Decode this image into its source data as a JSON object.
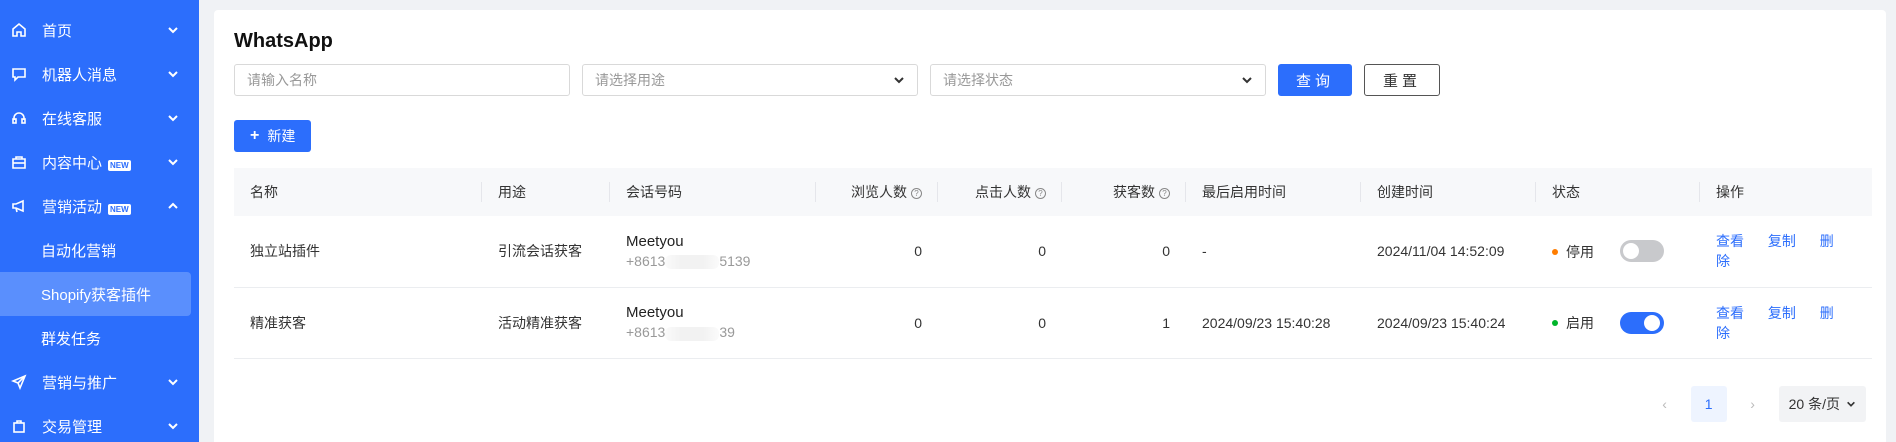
{
  "sidebar": {
    "items": [
      {
        "label": "首页",
        "icon": "home-icon"
      },
      {
        "label": "机器人消息",
        "icon": "chat-icon"
      },
      {
        "label": "在线客服",
        "icon": "headset-icon"
      },
      {
        "label": "内容中心",
        "icon": "folder-icon",
        "badge": "NEW"
      },
      {
        "label": "营销活动",
        "icon": "megaphone-icon",
        "badge": "NEW"
      },
      {
        "label": "营销与推广",
        "icon": "send-icon"
      },
      {
        "label": "交易管理",
        "icon": "bag-icon"
      }
    ],
    "subitems": [
      {
        "label": "自动化营销"
      },
      {
        "label": "Shopify获客插件"
      },
      {
        "label": "群发任务"
      }
    ]
  },
  "page": {
    "title": "WhatsApp"
  },
  "filters": {
    "name_placeholder": "请输入名称",
    "purpose_placeholder": "请选择用途",
    "status_placeholder": "请选择状态",
    "search_label": "查询",
    "reset_label": "重置"
  },
  "toolbar": {
    "new_label": "新建"
  },
  "table": {
    "headers": {
      "name": "名称",
      "purpose": "用途",
      "session": "会话号码",
      "views": "浏览人数",
      "clicks": "点击人数",
      "leads": "获客数",
      "last_enabled": "最后启用时间",
      "created": "创建时间",
      "status": "状态",
      "actions": "操作"
    },
    "rows": [
      {
        "name": "独立站插件",
        "purpose": "引流会话获客",
        "session_name": "Meetyou",
        "phone_prefix": "+8613",
        "phone_suffix": "5139",
        "views": "0",
        "clicks": "0",
        "leads": "0",
        "last_enabled": "-",
        "created": "2024/11/04 14:52:09",
        "status": "停用",
        "status_color": "#ff7d00"
      },
      {
        "name": "精准获客",
        "purpose": "活动精准获客",
        "session_name": "Meetyou",
        "phone_prefix": "+8613",
        "phone_suffix": "39",
        "views": "0",
        "clicks": "0",
        "leads": "1",
        "last_enabled": "2024/09/23 15:40:28",
        "created": "2024/09/23 15:40:24",
        "status": "启用",
        "status_color": "#00b42a"
      }
    ],
    "actions": {
      "view": "查看",
      "copy": "复制",
      "delete": "删除"
    }
  },
  "pagination": {
    "current_page": "1",
    "page_size": "20 条/页"
  }
}
